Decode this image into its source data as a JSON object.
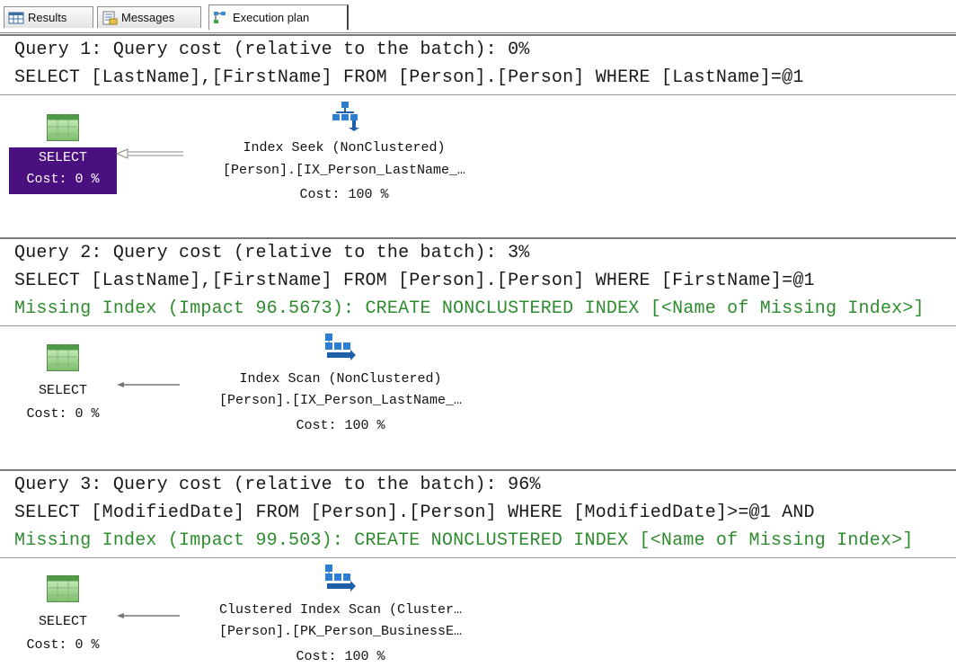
{
  "tabs": [
    {
      "label": "Results",
      "icon": "grid-icon"
    },
    {
      "label": "Messages",
      "icon": "messages-icon"
    },
    {
      "label": "Execution plan",
      "icon": "execution-plan-icon",
      "active": true
    }
  ],
  "queries": [
    {
      "header": "Query 1: Query cost (relative to the batch): 0%",
      "sql": "SELECT [LastName],[FirstName] FROM [Person].[Person] WHERE [LastName]=@1",
      "missing_index": "",
      "select_label": "SELECT",
      "select_cost": "Cost: 0 %",
      "select_selected": true,
      "op_line1": "Index Seek (NonClustered)",
      "op_line2": "[Person].[IX_Person_LastName_…",
      "op_cost": "Cost: 100 %",
      "op_icon": "index-seek-icon"
    },
    {
      "header": "Query 2: Query cost (relative to the batch): 3%",
      "sql": "SELECT [LastName],[FirstName] FROM [Person].[Person] WHERE [FirstName]=@1",
      "missing_index": "Missing Index (Impact 96.5673): CREATE NONCLUSTERED INDEX [<Name of Missing Index>]",
      "select_label": "SELECT",
      "select_cost": "Cost: 0 %",
      "select_selected": false,
      "op_line1": "Index Scan (NonClustered)",
      "op_line2": "[Person].[IX_Person_LastName_…",
      "op_cost": "Cost: 100 %",
      "op_icon": "index-scan-icon"
    },
    {
      "header": "Query 3: Query cost (relative to the batch): 96%",
      "sql": "SELECT [ModifiedDate] FROM [Person].[Person] WHERE [ModifiedDate]>=@1 AND",
      "missing_index": "Missing Index (Impact 99.503): CREATE NONCLUSTERED INDEX [<Name of Missing Index>]",
      "select_label": "SELECT",
      "select_cost": "Cost: 0 %",
      "select_selected": false,
      "op_line1": "Clustered Index Scan (Cluster…",
      "op_line2": "[Person].[PK_Person_BusinessE…",
      "op_cost": "Cost: 100 %",
      "op_icon": "clustered-index-scan-icon"
    }
  ],
  "colors": {
    "selected_bg": "#4b1080",
    "missing_index_text": "#2e8b2e",
    "text": "#1a1a1a"
  }
}
